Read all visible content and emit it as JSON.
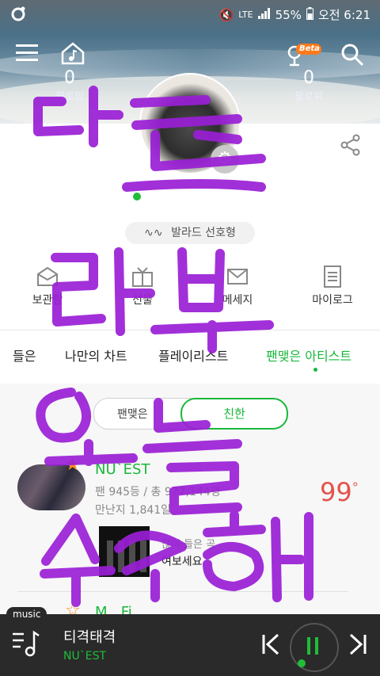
{
  "status": {
    "time": "오전 6:21",
    "battery": "55%",
    "network": "LTE"
  },
  "header": {
    "following_count": "0",
    "following_label": "팔로잉",
    "follower_count": "0",
    "follower_label": "팔로워",
    "beta": "Beta"
  },
  "profile": {
    "genre_tag": "발라드 선호형"
  },
  "menu": [
    "보관함",
    "선물",
    "메세지",
    "마이로그"
  ],
  "tabs": [
    "들은",
    "나만의 차트",
    "플레이리스트",
    "팬맺은 아티스트"
  ],
  "toggle": {
    "left": "팬맺은",
    "right": "친한"
  },
  "artist": {
    "name": "NU`EST",
    "fan_rank": "팬 945등 / 총 977,144명",
    "since": "만난지 1,841일",
    "temperature": "99",
    "temp_unit": "°",
    "song_label": "많이 들은 곡",
    "song_title": "여보세요"
  },
  "artist2": {
    "name": "M...Fi"
  },
  "player": {
    "chip": "music",
    "title": "티격태격",
    "artist": "NU`EST"
  },
  "colors": {
    "accent": "#18b83b",
    "temperature": "#e3524b",
    "star": "#ff8a1e"
  }
}
